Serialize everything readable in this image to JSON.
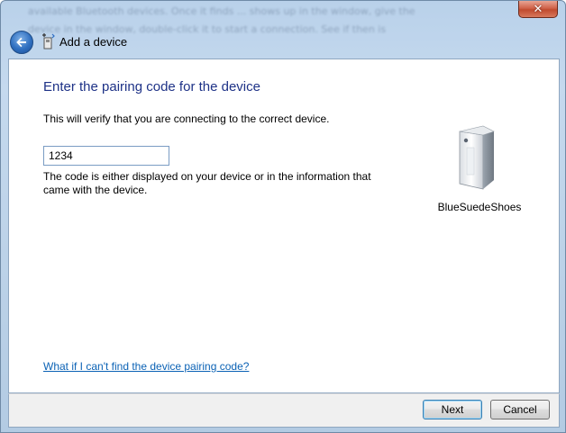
{
  "window": {
    "title": "Add a device",
    "background_text_1": "available Bluetooth devices. Once it finds ... shows up in the window, give the",
    "background_text_2": "device in the window, double-click it to start a connection. See if then is",
    "close_label": "✕"
  },
  "page": {
    "heading": "Enter the pairing code for the device",
    "info": "This will verify that you are connecting to the correct device.",
    "code_value": "1234",
    "hint": "The code is either displayed on your device or in the information that came with the device.",
    "device_name": "BlueSuedeShoes",
    "help_link": "What if I can't find the device pairing code?"
  },
  "footer": {
    "next_label": "Next",
    "cancel_label": "Cancel"
  },
  "icons": {
    "back": "back-arrow-icon",
    "title": "add-device-icon",
    "device": "bluetooth-device-icon",
    "close": "close-icon"
  }
}
